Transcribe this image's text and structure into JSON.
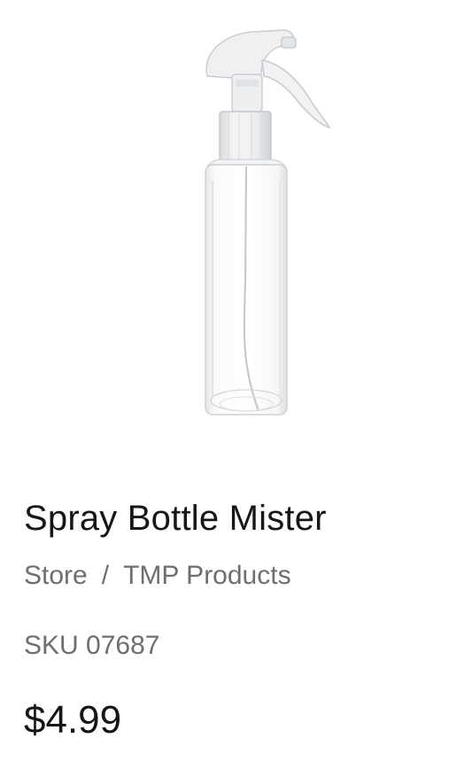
{
  "product": {
    "title": "Spray Bottle Mister",
    "sku_label": "SKU",
    "sku": "07687",
    "price": "$4.99",
    "image_icon": "spray-bottle-image"
  },
  "breadcrumb": {
    "items": [
      "Store",
      "TMP Products"
    ],
    "separator": "/"
  }
}
